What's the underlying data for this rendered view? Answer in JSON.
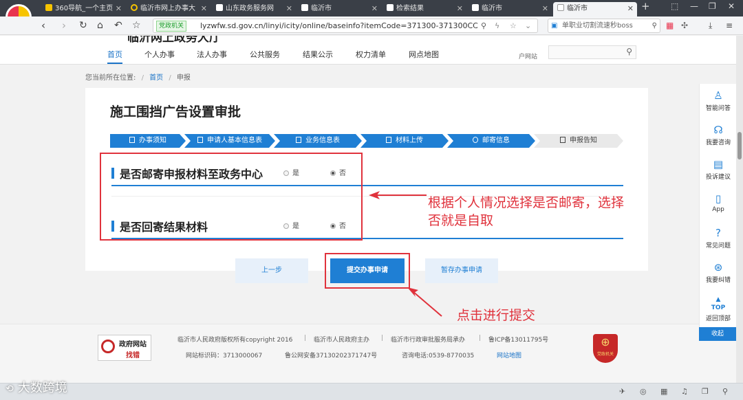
{
  "browser": {
    "tabs": [
      {
        "label": "360导航_一个主页"
      },
      {
        "label": "临沂市网上办事大"
      },
      {
        "label": "山东政务服务网"
      },
      {
        "label": "临沂市"
      },
      {
        "label": "检索结果"
      },
      {
        "label": "临沂市"
      },
      {
        "label": "临沂市"
      }
    ],
    "secure_badge": "党政机关",
    "url": "lyzwfw.sd.gov.cn/linyi/icity/online/baseinfo?itemCode=371300-371300CC",
    "search_box": "单职业切割流速秒boss"
  },
  "header": {
    "site_title": "临沂网上政务大厅",
    "nav": [
      "首页",
      "个人办事",
      "法人办事",
      "公共服务",
      "结果公示",
      "权力清单",
      "网点地图"
    ],
    "account_hint": "户网站"
  },
  "breadcrumb": {
    "prefix": "您当前所在位置:",
    "home": "首页",
    "current": "申报"
  },
  "form": {
    "title": "施工围挡广告设置审批",
    "steps": [
      "办事须知",
      "申请人基本信息表",
      "业务信息表",
      "材料上传",
      "邮寄信息",
      "申报告知"
    ],
    "questions": [
      {
        "label": "是否邮寄申报材料至政务中心",
        "yes": "是",
        "no": "否",
        "selected": "否"
      },
      {
        "label": "是否回寄结果材料",
        "yes": "是",
        "no": "否",
        "selected": "否"
      }
    ],
    "buttons": {
      "prev": "上一步",
      "submit": "提交办事申请",
      "save": "暂存办事申请"
    }
  },
  "annotations": {
    "mail_note_line1": "根据个人情况选择是否邮寄，选择",
    "mail_note_line2": "否就是自取",
    "submit_note": "点击进行提交",
    "color": "#e0323c"
  },
  "footer": {
    "badge_line1": "政府网站",
    "badge_line2": "找错",
    "copyright": "临沂市人民政府版权所有copyright 2016",
    "host": "临沂市人民政府主办",
    "operator": "临沂市行政审批服务局承办",
    "icp": "鲁ICP备13011795号",
    "site_id": "网站标识码：3713000067",
    "police": "鲁公网安备37130202371747号",
    "phone": "咨询电话:0539-8770035",
    "sitemap": "网站地图",
    "emblem": "党政机关"
  },
  "sidebar": {
    "items": [
      "智能问答",
      "我要咨询",
      "投诉建议",
      "App",
      "常见问题",
      "我要纠错"
    ],
    "top_label": "TOP",
    "top_text": "返回顶部",
    "collapse": "收起"
  },
  "watermark": "大数跨境",
  "colors": {
    "primary": "#1f7fd4",
    "highlight": "#e0323c"
  }
}
